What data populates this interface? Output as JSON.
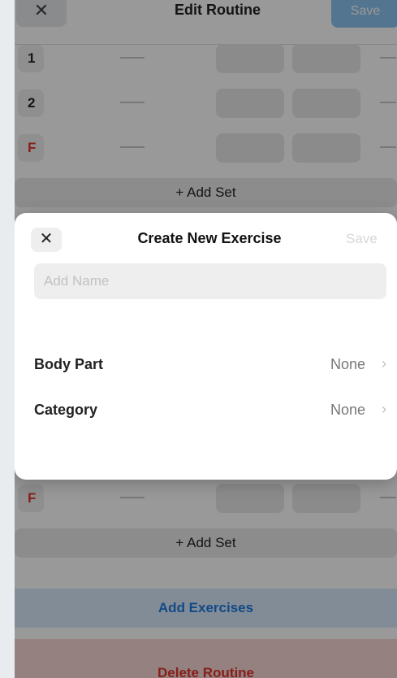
{
  "header": {
    "close": "✕",
    "title": "Edit Routine",
    "save": "Save"
  },
  "sets_top": [
    {
      "label": "1"
    },
    {
      "label": "2"
    },
    {
      "label": "F"
    }
  ],
  "add_set_top": "+ Add Set",
  "sets_bottom": [
    {
      "label": "F"
    }
  ],
  "add_set_bottom": "+ Add Set",
  "add_exercises": "Add Exercises",
  "delete_routine": "Delete Routine",
  "modal": {
    "close": "✕",
    "title": "Create New Exercise",
    "save": "Save",
    "name_placeholder": "Add Name",
    "name_value": "",
    "body_part_label": "Body Part",
    "body_part_value": "None",
    "category_label": "Category",
    "category_value": "None",
    "chevron": "›"
  },
  "colors": {
    "accent": "#1f7ae0",
    "danger": "#e0362e",
    "save_disabled": "#8cc3f0"
  }
}
